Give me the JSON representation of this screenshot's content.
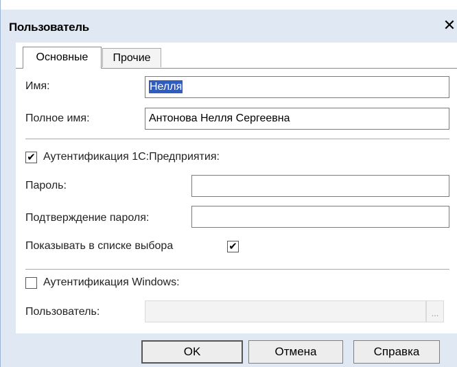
{
  "window": {
    "title": "Пользователь",
    "close_glyph": "✕"
  },
  "tabs": [
    {
      "label": "Основные",
      "active": true
    },
    {
      "label": "Прочие",
      "active": false
    }
  ],
  "fields": {
    "name_label": "Имя:",
    "name_value": "Нелля",
    "full_name_label": "Полное имя:",
    "full_name_value": "Антонова Нелля Сергеевна"
  },
  "auth_1c": {
    "label": "Аутентификация 1С:Предприятия:",
    "checked": true,
    "password_label": "Пароль:",
    "password_value": "",
    "confirm_label": "Подтверждение пароля:",
    "confirm_value": "",
    "show_in_list_label": "Показывать в списке выбора",
    "show_in_list_checked": true
  },
  "auth_windows": {
    "label": "Аутентификация Windows:",
    "checked": false,
    "user_label": "Пользователь:",
    "user_value": "",
    "browse_glyph": "..."
  },
  "buttons": {
    "ok": "OK",
    "cancel": "Отмена",
    "help": "Справка"
  },
  "icons": {
    "close": "close-icon",
    "check": "checkmark-icon",
    "browse": "ellipsis-icon"
  },
  "colors": {
    "frame": "#dfe8f3",
    "selection": "#2f5dbf"
  }
}
